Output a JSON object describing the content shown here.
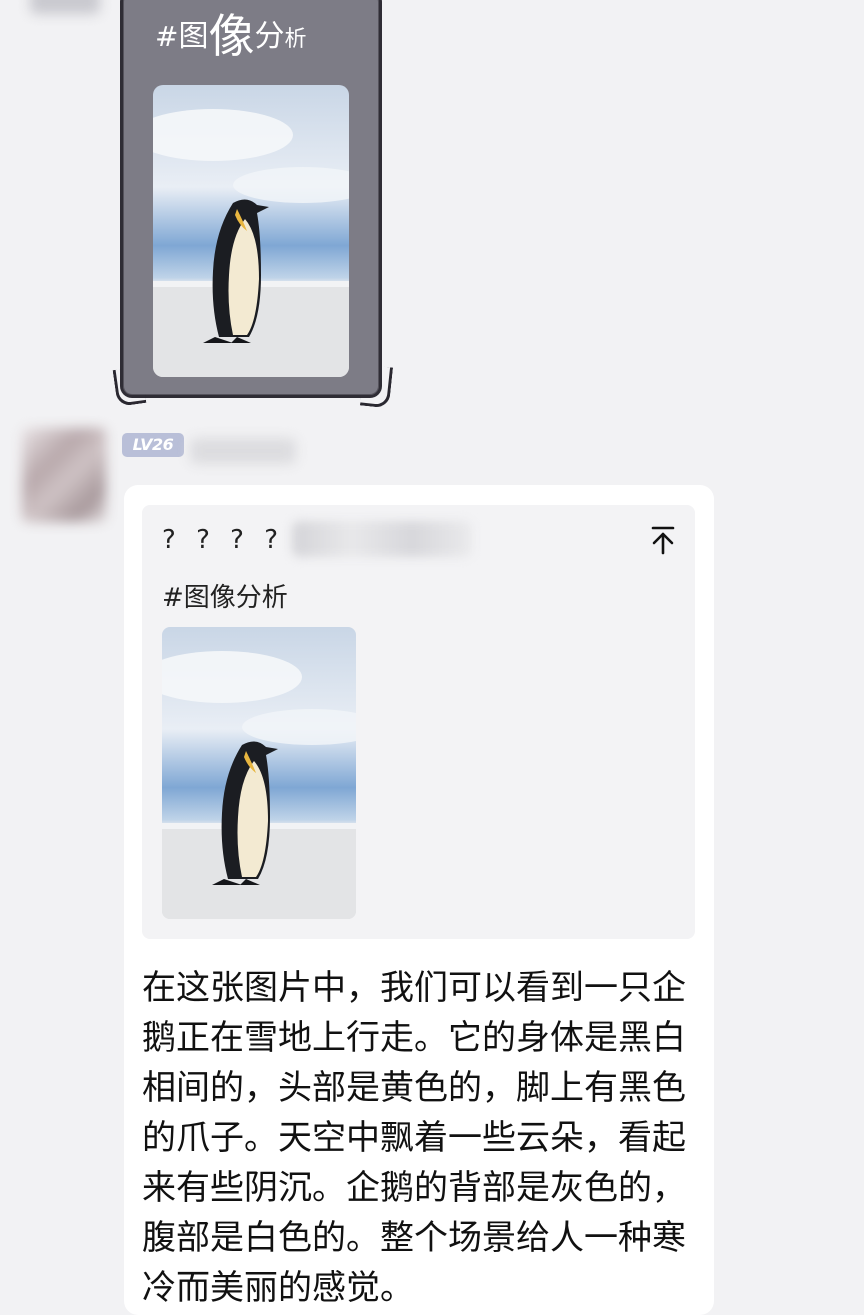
{
  "sent_card": {
    "title_hash": "#",
    "title_char1": "图",
    "title_char2": "像",
    "title_char3": "分",
    "title_char4": "析",
    "image_icon": "penguin-photo"
  },
  "reply": {
    "level_badge": "LV26",
    "quote": {
      "meta_prefix": "? ? ? ?",
      "tag": "#图像分析",
      "image_icon": "penguin-photo",
      "pin_icon": "pin-to-top-icon"
    },
    "message": "在这张图片中，我们可以看到一只企鹅正在雪地上行走。它的身体是黑白相间的，头部是黄色的，脚上有黑色的爪子。天空中飘着一些云朵，看起来有些阴沉。企鹅的背部是灰色的，腹部是白色的。整个场景给人一种寒冷而美丽的感觉。"
  },
  "colors": {
    "background": "#f2f2f4",
    "frame": "#7d7c86",
    "badge": "#b9bfd8",
    "bubble": "#ffffff",
    "quote_bg": "#f3f3f5"
  }
}
